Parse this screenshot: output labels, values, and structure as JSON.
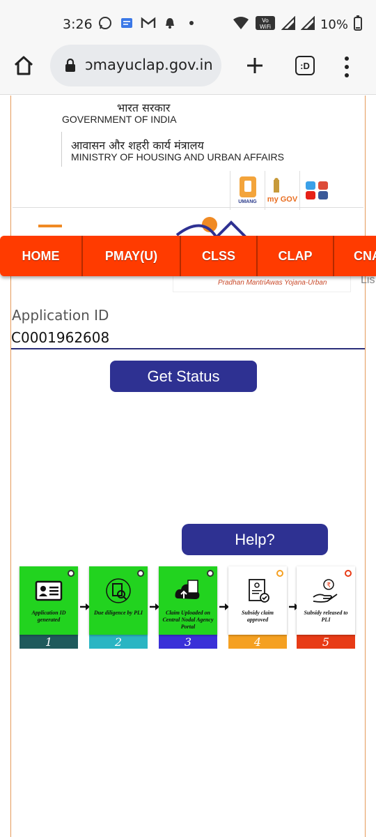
{
  "status_bar": {
    "time": "3:26",
    "battery": "10%",
    "icons": [
      "whatsapp-icon",
      "messages-icon",
      "gmail-icon",
      "notification-bell-icon",
      "dot-icon",
      "wifi-icon",
      "vowifi-icon",
      "signal-icon",
      "signal-icon",
      "battery-icon"
    ],
    "vowifi": "Vo WiFi"
  },
  "browser": {
    "url": "ɔmayuclap.gov.in",
    "tabs_label": ":D"
  },
  "header": {
    "gov_hindi": "भारत सरकार",
    "gov_english": "GOVERNMENT OF INDIA",
    "ministry_hindi": "आवासन और शहरी कार्य मंत्रालय",
    "ministry_english": "MINISTRY OF HOUSING AND URBAN AFFAIRS",
    "umang_label": "UMANG",
    "mygov_label": "my GOV"
  },
  "banner": {
    "tagline": "Pradhan MantriAwas Yojana-Urban",
    "side_text": "Lis"
  },
  "nav": {
    "items": [
      {
        "label": "HOME"
      },
      {
        "label": "PMAY(U)"
      },
      {
        "label": "CLSS"
      },
      {
        "label": "CLAP"
      },
      {
        "label": "CNA PL"
      }
    ]
  },
  "form": {
    "label": "Application ID",
    "value": "C0001962608",
    "submit_label": "Get Status",
    "help_label": "Help?"
  },
  "steps": [
    {
      "number": "1",
      "label": "Application ID generated",
      "color": "#1f5a5c",
      "bg": "#22d31f"
    },
    {
      "number": "2",
      "label": "Due diligence by PLI",
      "color": "#2ab5c3",
      "bg": "#22d31f"
    },
    {
      "number": "3",
      "label": "Claim Uploaded on Central Nodal Agency Portal",
      "color": "#3a30d8",
      "bg": "#22d31f"
    },
    {
      "number": "4",
      "label": "Subsidy claim approved",
      "color": "#f5a021",
      "bg": "#ffffff"
    },
    {
      "number": "5",
      "label": "Subsidy released to PLI",
      "color": "#e83b16",
      "bg": "#ffffff"
    }
  ]
}
